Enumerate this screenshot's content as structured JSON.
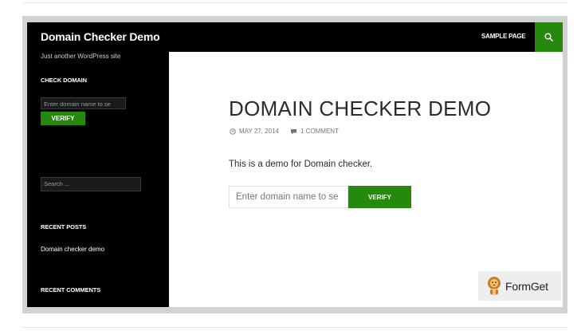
{
  "header": {
    "site_title": "Domain Checker Demo",
    "nav_link": "SAMPLE PAGE",
    "search_icon": "search-icon"
  },
  "sidebar": {
    "tagline": "Just another WordPress site",
    "check_domain_title": "CHECK DOMAIN",
    "domain_placeholder": "Enter domain name to se",
    "verify_label": "VERIFY",
    "search_placeholder": "Search ...",
    "recent_posts_title": "RECENT POSTS",
    "recent_posts": [
      "Domain checker demo"
    ],
    "recent_comments_title": "RECENT COMMENTS"
  },
  "post": {
    "title": "DOMAIN CHECKER DEMO",
    "date": "MAY 27, 2014",
    "comments": "1 COMMENT",
    "text": "This is a demo for Domain checker.",
    "domain_placeholder": "Enter domain name to se",
    "verify_label": "VERIFY"
  },
  "watermark": {
    "text": "FormGet"
  },
  "colors": {
    "accent": "#24890d",
    "header_bg": "#000000",
    "title_text": "#2b2b2b"
  }
}
